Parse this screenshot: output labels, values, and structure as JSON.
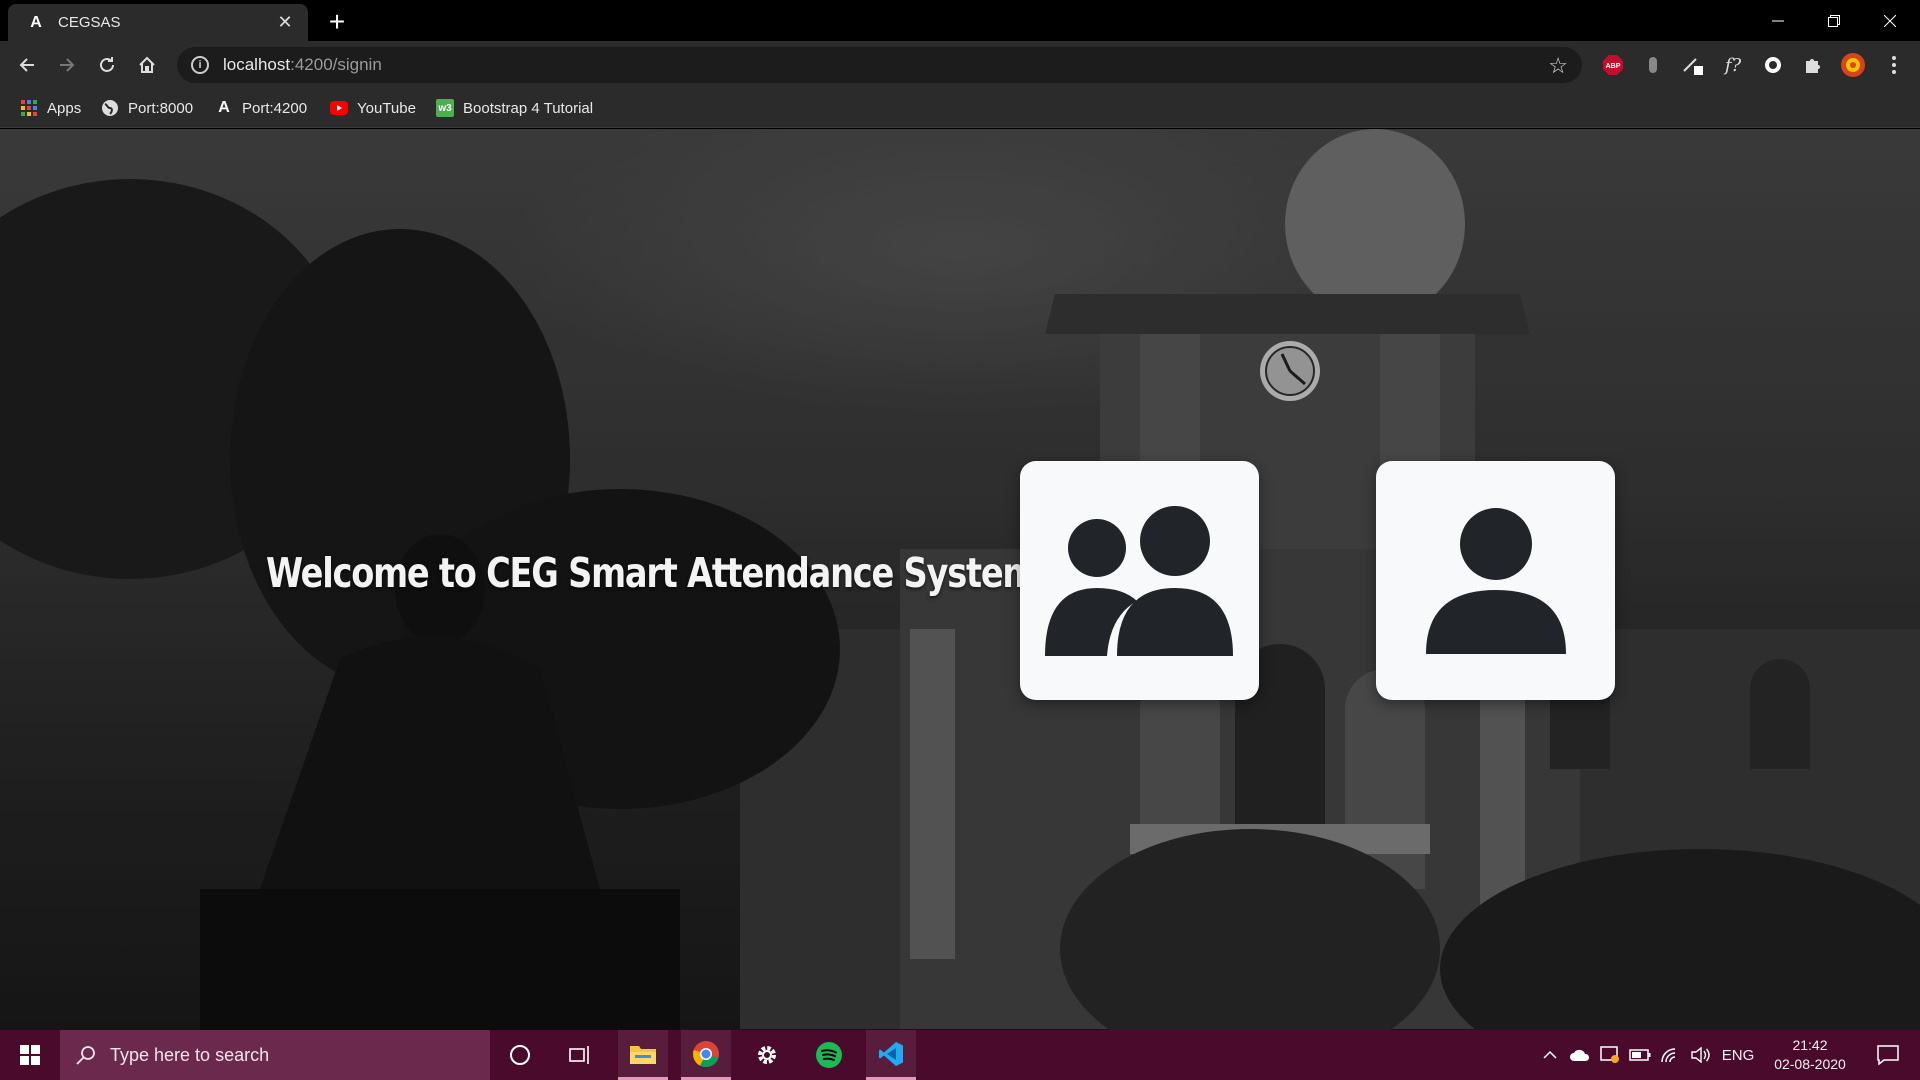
{
  "browser": {
    "tab": {
      "favicon": "A",
      "title": "CEGSAS",
      "close": "✕"
    },
    "new_tab": "+",
    "window_controls": {
      "minimize": "—",
      "restore": "❐",
      "close": "✕"
    },
    "url": {
      "host": "localhost",
      "path": ":4200/signin"
    },
    "extensions": [
      "abp-icon",
      "extension-icon",
      "pen-icon",
      "formula-icon",
      "circle-icon",
      "puzzle-icon",
      "profile-avatar"
    ],
    "abp_label": "ABP",
    "formula_label": "f?"
  },
  "bookmarks": [
    {
      "label": "Apps",
      "icon": "apps-grid-icon"
    },
    {
      "label": "Port:8000",
      "icon": "globe-icon"
    },
    {
      "label": "Port:4200",
      "icon": "angular-icon"
    },
    {
      "label": "YouTube",
      "icon": "youtube-icon"
    },
    {
      "label": "Bootstrap 4 Tutorial",
      "icon": "w3schools-icon"
    }
  ],
  "bookmark_icon_text": {
    "port4200": "A",
    "w3": "w3"
  },
  "page": {
    "welcome_text": "Welcome to CEG Smart Attendance System",
    "cards": [
      {
        "role": "group",
        "icon": "people-group-icon"
      },
      {
        "role": "individual",
        "icon": "person-icon"
      }
    ]
  },
  "taskbar": {
    "search_placeholder": "Type here to search",
    "apps": [
      "cortana-icon",
      "task-view-icon",
      "file-explorer-icon",
      "chrome-icon",
      "settings-icon",
      "spotify-icon",
      "vscode-icon"
    ],
    "language": "ENG",
    "time": "21:42",
    "date": "02-08-2020"
  }
}
